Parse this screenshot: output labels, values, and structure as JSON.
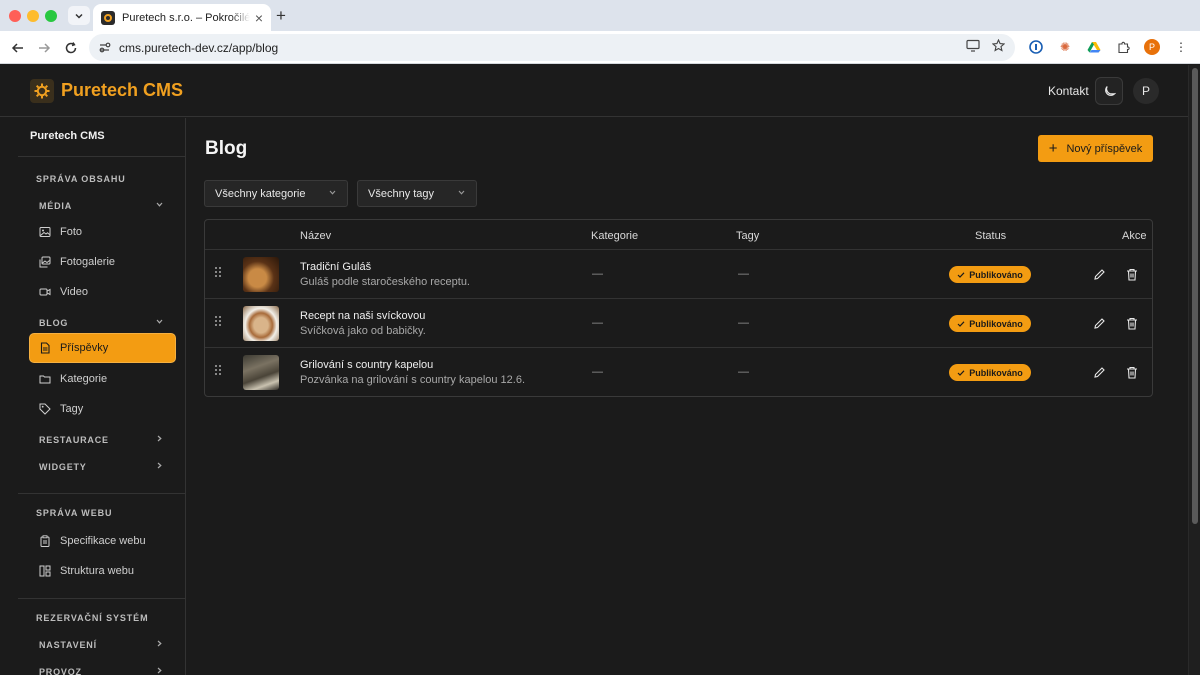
{
  "browser": {
    "tab_title": "Puretech s.r.o. – Pokročilé webové",
    "url": "cms.puretech-dev.cz/app/blog",
    "profile_initial": "P"
  },
  "header": {
    "brand": "Puretech CMS",
    "contact_label": "Kontakt",
    "user_initial": "P"
  },
  "sidebar": {
    "title": "Puretech CMS",
    "section_content": "SPRÁVA OBSAHU",
    "group_media": "MÉDIA",
    "media_items": [
      {
        "label": "Foto",
        "icon": "image-icon"
      },
      {
        "label": "Fotogalerie",
        "icon": "gallery-icon"
      },
      {
        "label": "Video",
        "icon": "video-icon"
      }
    ],
    "group_blog": "BLOG",
    "blog_items": [
      {
        "label": "Příspěvky",
        "icon": "document-icon",
        "active": true
      },
      {
        "label": "Kategorie",
        "icon": "folder-icon"
      },
      {
        "label": "Tagy",
        "icon": "tag-icon"
      }
    ],
    "group_restaurant": "RESTAURACE",
    "group_widgets": "WIDGETY",
    "section_web": "SPRÁVA WEBU",
    "web_items": [
      {
        "label": "Specifikace webu",
        "icon": "clipboard-icon"
      },
      {
        "label": "Struktura webu",
        "icon": "layout-icon"
      }
    ],
    "section_reservation": "REZERVAČNÍ SYSTÉM",
    "group_settings": "NASTAVENÍ",
    "group_operation": "PROVOZ"
  },
  "main": {
    "title": "Blog",
    "new_post_label": "Nový příspěvek",
    "filter_categories": "Všechny kategorie",
    "filter_tags": "Všechny tagy",
    "columns": {
      "name": "Název",
      "category": "Kategorie",
      "tags": "Tagy",
      "status": "Status",
      "actions": "Akce"
    },
    "rows": [
      {
        "title": "Tradiční Guláš",
        "description": "Guláš podle staročeského receptu.",
        "category": "—",
        "tags": "—",
        "status": "Publikováno"
      },
      {
        "title": "Recept na naši svíckovou",
        "description": "Svíčková jako od babičky.",
        "category": "—",
        "tags": "—",
        "status": "Publikováno"
      },
      {
        "title": "Grilování s country kapelou",
        "description": "Pozvánka na grilování s country kapelou 12.6.",
        "category": "—",
        "tags": "—",
        "status": "Publikováno"
      }
    ]
  },
  "colors": {
    "accent": "#f39c12",
    "background": "#1b1b1b",
    "border": "#3a3a3a"
  }
}
